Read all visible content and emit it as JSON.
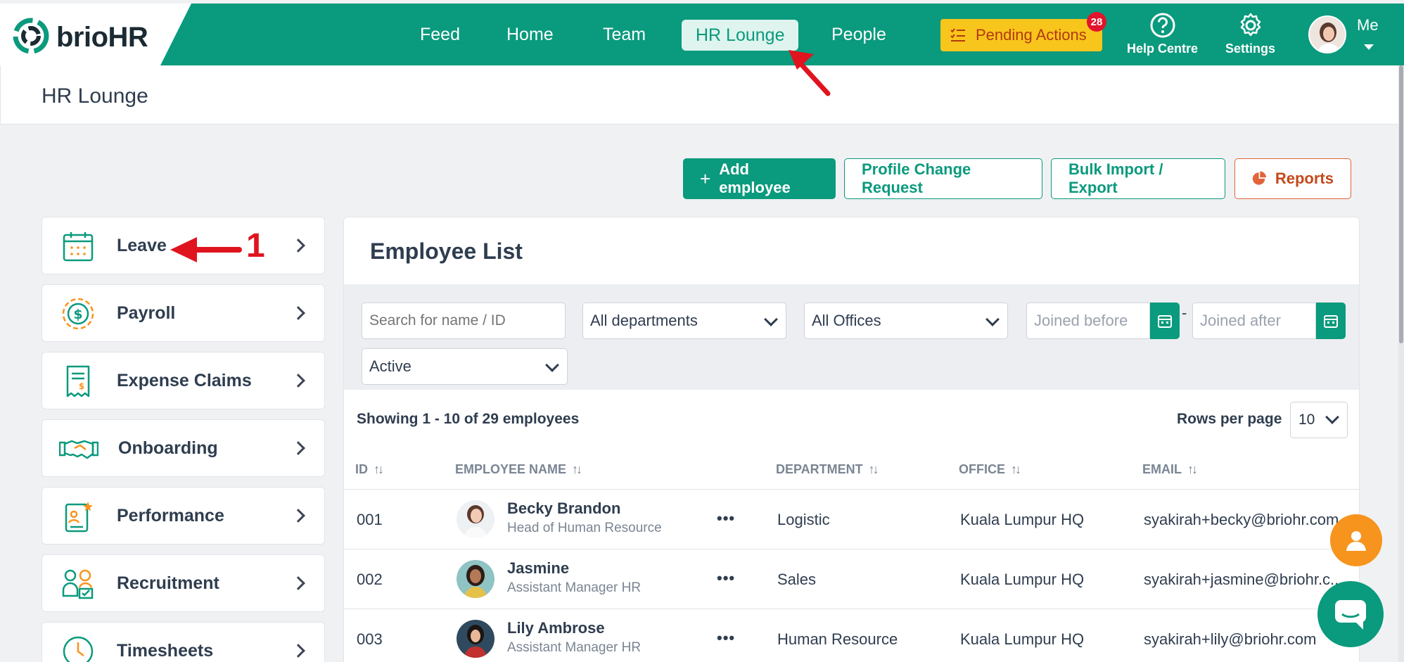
{
  "brand": {
    "name_part1": "brio",
    "name_part2": "HR"
  },
  "nav": {
    "feed": "Feed",
    "home": "Home",
    "team": "Team",
    "hr_lounge": "HR Lounge",
    "people": "People"
  },
  "pending": {
    "label": "Pending Actions",
    "count": "28"
  },
  "help_label": "Help Centre",
  "settings_label": "Settings",
  "me_label": "Me",
  "page_title": "HR Lounge",
  "actions": {
    "add": "Add employee",
    "add_icon": "+",
    "profile_change": "Profile Change Request",
    "bulk": "Bulk Import / Export",
    "reports": "Reports"
  },
  "sidebar": [
    {
      "label": "Leave",
      "icon": "calendar-icon"
    },
    {
      "label": "Payroll",
      "icon": "dollar-coin-icon"
    },
    {
      "label": "Expense Claims",
      "icon": "receipt-icon"
    },
    {
      "label": "Onboarding",
      "icon": "handshake-icon"
    },
    {
      "label": "Performance",
      "icon": "performance-icon"
    },
    {
      "label": "Recruitment",
      "icon": "recruitment-icon"
    },
    {
      "label": "Timesheets",
      "icon": "clock-icon"
    }
  ],
  "annotation": {
    "number": "1"
  },
  "employee_list": {
    "title": "Employee List",
    "search_placeholder": "Search for name / ID",
    "department": "All departments",
    "office": "All Offices",
    "joined_before": "Joined before",
    "joined_after": "Joined after",
    "status": "Active",
    "date_separator": "-",
    "showing": "Showing 1 - 10 of 29 employees",
    "rows_per_page_label": "Rows per page",
    "rows_per_page_value": "10",
    "columns": {
      "id": "ID",
      "name": "EMPLOYEE NAME",
      "department": "DEPARTMENT",
      "office": "OFFICE",
      "email": "EMAIL"
    },
    "more_glyph": "•••",
    "rows": [
      {
        "id": "001",
        "name": "Becky Brandon",
        "title": "Head of Human Resource",
        "department": "Logistic",
        "office": "Kuala Lumpur HQ",
        "email": "syakirah+becky@briohr.com"
      },
      {
        "id": "002",
        "name": "Jasmine",
        "title": "Assistant Manager HR",
        "department": "Sales",
        "office": "Kuala Lumpur HQ",
        "email": "syakirah+jasmine@briohr.c..."
      },
      {
        "id": "003",
        "name": "Lily Ambrose",
        "title": "Assistant Manager HR",
        "department": "Human Resource",
        "office": "Kuala Lumpur HQ",
        "email": "syakirah+lily@briohr.com"
      }
    ]
  },
  "colors": {
    "brand_green": "#0a9a7d",
    "pending_yellow": "#f8c51c",
    "badge_red": "#e1142c",
    "reports_orange": "#e2643a",
    "annotation_red": "#e0141f"
  }
}
